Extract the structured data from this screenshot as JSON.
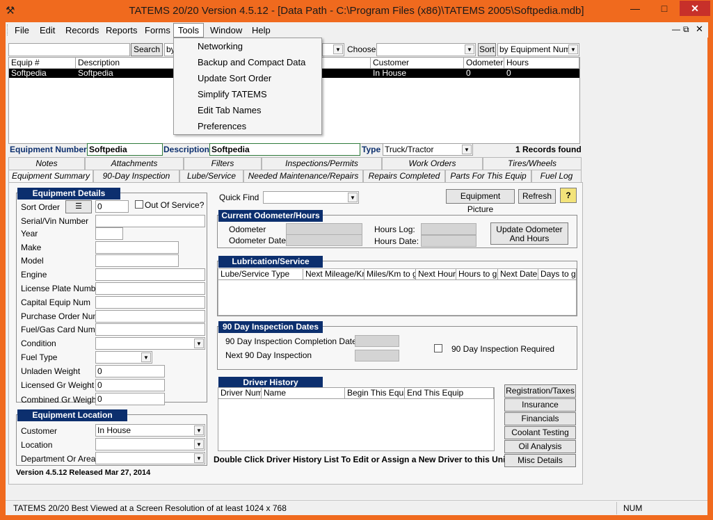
{
  "window": {
    "title": "TATEMS 20/20 Version 4.5.12 - [Data Path - C:\\Program Files (x86)\\TATEMS 2005\\Softpedia.mdb]"
  },
  "menubar": {
    "file": "File",
    "edit": "Edit",
    "records": "Records",
    "reports": "Reports",
    "forms": "Forms",
    "tools": "Tools",
    "window": "Window",
    "help": "Help"
  },
  "tools_menu": {
    "items": [
      "Networking",
      "Backup and Compact Data",
      "Update Sort Order",
      "Simplify TATEMS",
      "Edit Tab Names",
      "Preferences"
    ]
  },
  "search": {
    "button": "Search",
    "by_prefix": "by",
    "choose_label": "Choose",
    "sort_label": "Sort",
    "sort_value": "by Equipment Num"
  },
  "grid": {
    "headers": [
      "Equip #",
      "Description",
      "Customer",
      "Odometer",
      "Hours"
    ],
    "rows": [
      {
        "equip": "Softpedia",
        "description": "Softpedia",
        "customer": "In House",
        "odometer": "0",
        "hours": "0"
      }
    ]
  },
  "record_bar": {
    "equip_num_label": "Equipment Number",
    "equip_num": "Softpedia",
    "desc_label": "Description",
    "desc": "Softpedia",
    "type_label": "Type",
    "type_value": "Truck/Tractor",
    "records_found": "1 Records found"
  },
  "tabs_row1": [
    "Notes",
    "Attachments",
    "Filters",
    "Inspections/Permits",
    "Work Orders",
    "Tires/Wheels"
  ],
  "tabs_row2": [
    "Equipment Summary",
    "90-Day Inspection",
    "Lube/Service",
    "Needed Maintenance/Repairs",
    "Repairs Completed",
    "Parts For This Equip",
    "Fuel Log"
  ],
  "details": {
    "header": "Equipment Details",
    "sort_order_label": "Sort Order",
    "sort_order_value": "0",
    "out_of_service": "Out Of Service?",
    "serial": "Serial/Vin Number",
    "year": "Year",
    "make": "Make",
    "model": "Model",
    "engine": "Engine",
    "license": "License Plate Number",
    "capital": "Capital Equip Num",
    "po": "Purchase Order Num",
    "fuel_card": "Fuel/Gas Card Num",
    "condition": "Condition",
    "fuel_type": "Fuel Type",
    "unladen": "Unladen Weight",
    "unladen_value": "0",
    "licensed": "Licensed Gr Weight",
    "licensed_value": "0",
    "combined": "Combined Gr Weight",
    "combined_value": "0"
  },
  "location": {
    "header": "Equipment Location",
    "customer_label": "Customer",
    "customer_value": "In House",
    "location_label": "Location",
    "dept_label": "Department Or Area"
  },
  "version_text": "Version 4.5.12 Released Mar 27, 2014",
  "right": {
    "quick_find": "Quick Find",
    "equip_picture": "Equipment Picture",
    "refresh": "Refresh",
    "help_icon": "?",
    "odo_header": "Current Odometer/Hours",
    "odometer": "Odometer",
    "odometer_date": "Odometer Date",
    "hours_log": "Hours Log:",
    "hours_date": "Hours Date:",
    "update_btn_l1": "Update Odometer",
    "update_btn_l2": "And  Hours",
    "lube_header": "Lubrication/Service",
    "lube_cols": [
      "Lube/Service Type",
      "Next Mileage/Km",
      "Miles/Km to go",
      "Next Hours",
      "Hours to go",
      "Next Date",
      "Days to go"
    ],
    "insp_header": "90 Day Inspection Dates",
    "insp_completion": "90 Day Inspection Completion Date",
    "insp_next": "Next 90 Day Inspection",
    "insp_required": "90 Day Inspection Required",
    "driver_header": "Driver History",
    "driver_cols": [
      "Driver Num",
      "Name",
      "Begin This Equip",
      "End This Equip"
    ],
    "driver_hint": "Double Click Driver History List To Edit or Assign a New Driver to this Unit",
    "side_buttons": [
      "Registration/Taxes",
      "Insurance",
      "Financials",
      "Coolant Testing",
      "Oil Analysis",
      "Misc Details"
    ]
  },
  "statusbar": {
    "message": "TATEMS 20/20 Best Viewed at a Screen Resolution of at least 1024 x 768",
    "num": "NUM"
  }
}
